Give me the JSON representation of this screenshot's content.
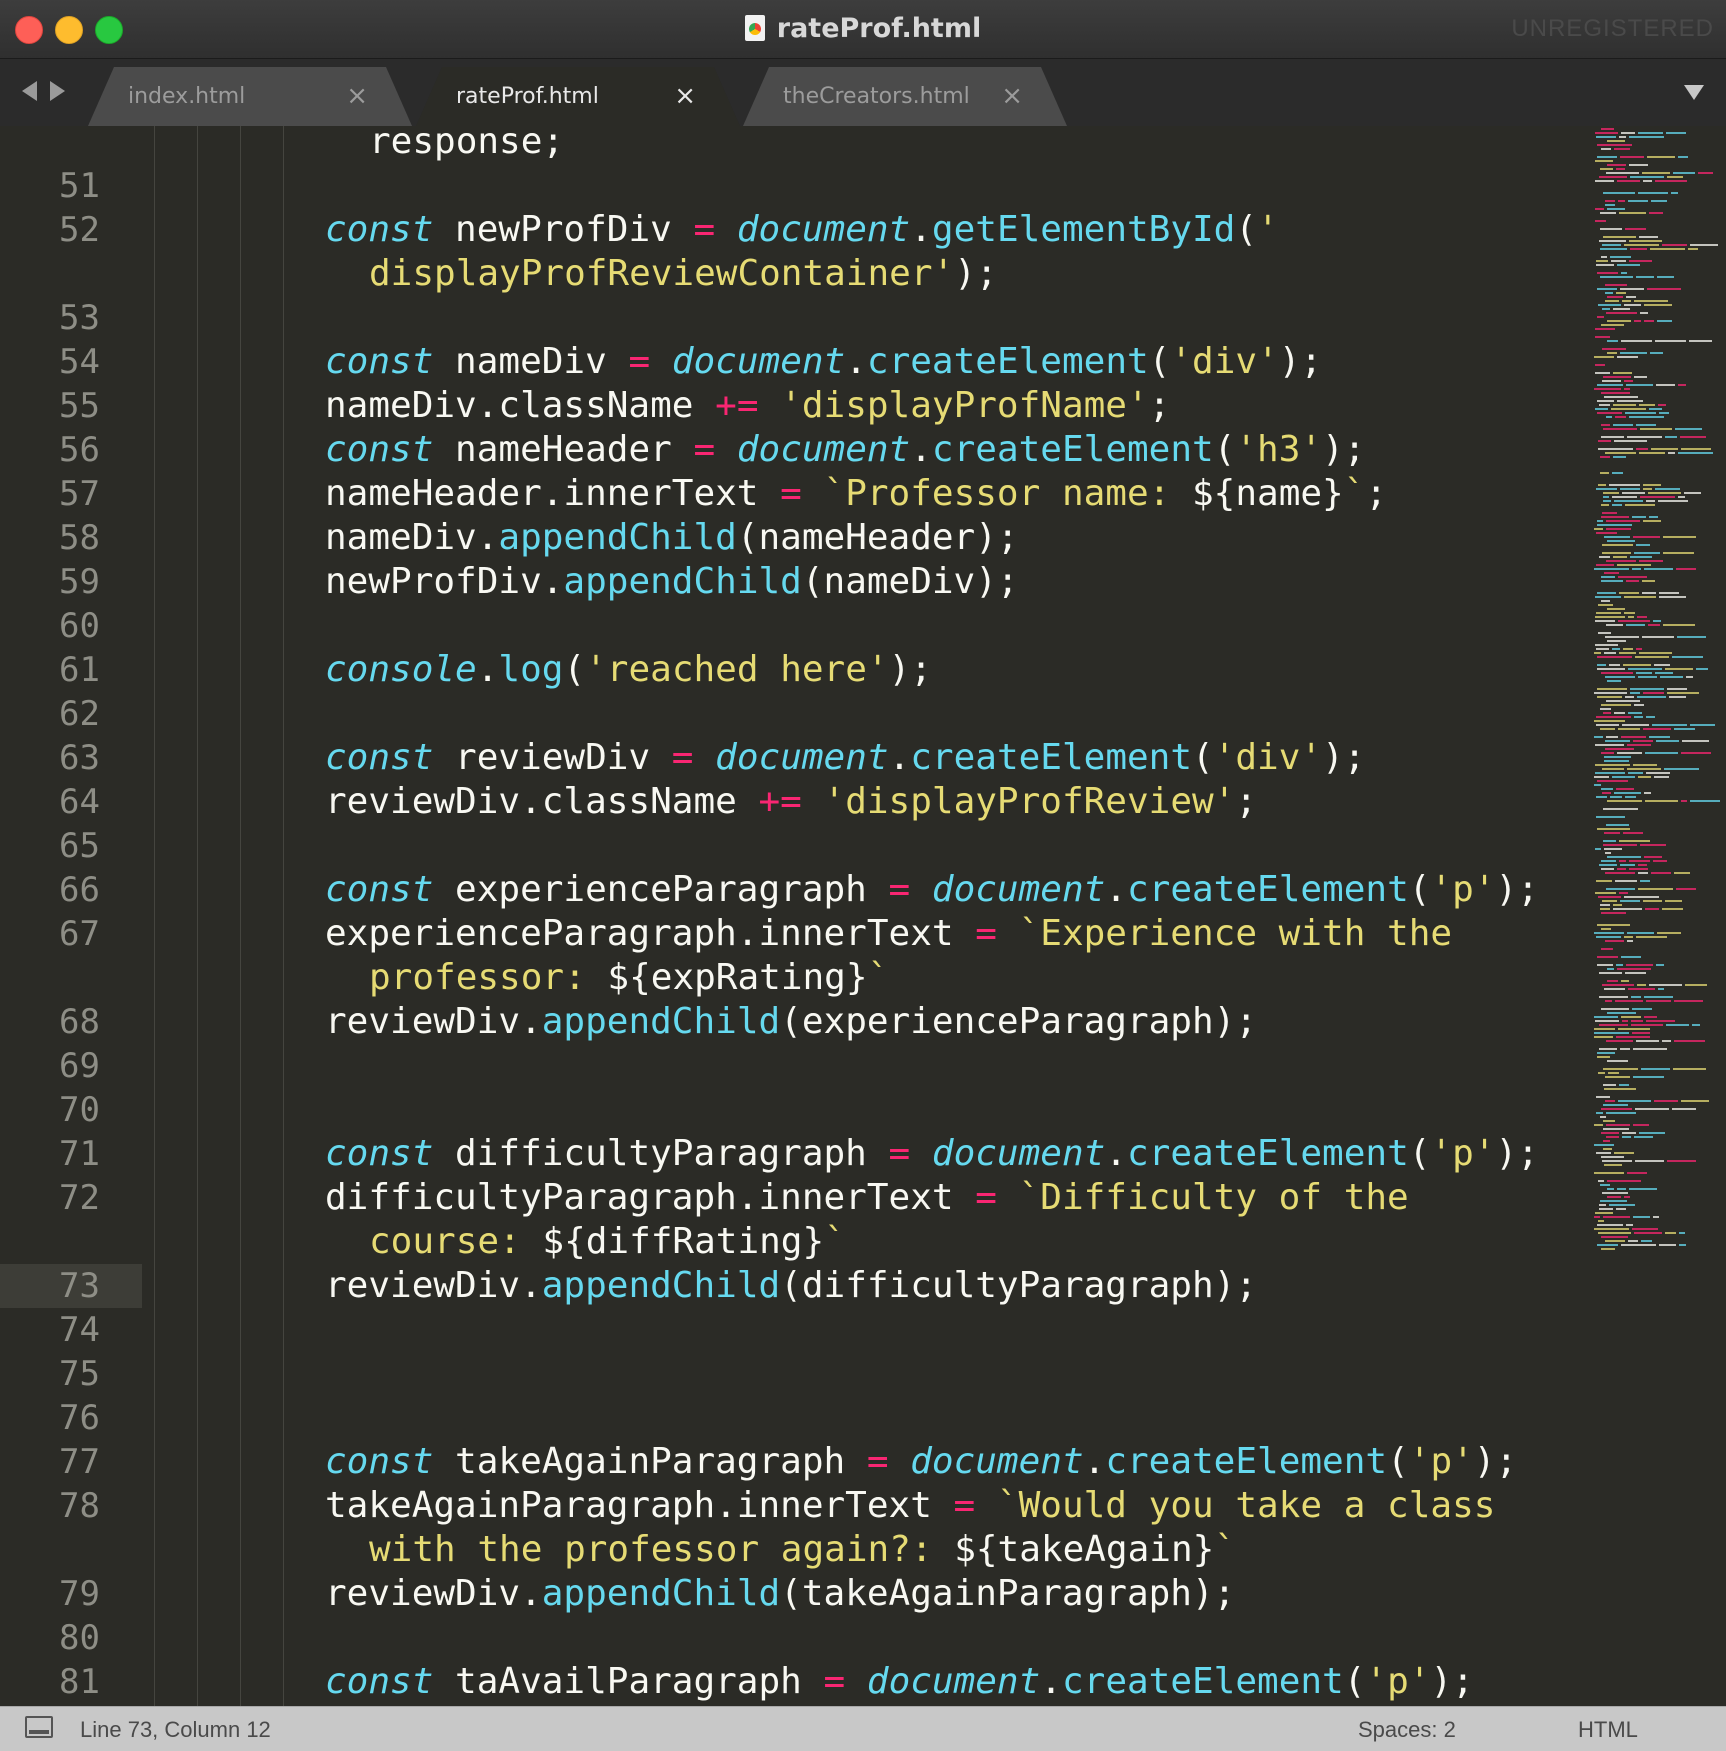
{
  "window": {
    "title": "rateProf.html",
    "registration": "UNREGISTERED"
  },
  "tabs": [
    {
      "label": "index.html",
      "active": false,
      "close": "×"
    },
    {
      "label": "rateProf.html",
      "active": true,
      "close": "×"
    },
    {
      "label": "theCreators.html",
      "active": false,
      "close": "×"
    }
  ],
  "gutter": {
    "current_line": 73,
    "rows": [
      {
        "n": ""
      },
      {
        "n": "51"
      },
      {
        "n": "52"
      },
      {
        "n": ""
      },
      {
        "n": "53"
      },
      {
        "n": "54"
      },
      {
        "n": "55"
      },
      {
        "n": "56"
      },
      {
        "n": "57"
      },
      {
        "n": "58"
      },
      {
        "n": "59"
      },
      {
        "n": "60"
      },
      {
        "n": "61"
      },
      {
        "n": "62"
      },
      {
        "n": "63"
      },
      {
        "n": "64"
      },
      {
        "n": "65"
      },
      {
        "n": "66"
      },
      {
        "n": "67"
      },
      {
        "n": ""
      },
      {
        "n": "68"
      },
      {
        "n": "69"
      },
      {
        "n": "70"
      },
      {
        "n": "71"
      },
      {
        "n": "72"
      },
      {
        "n": ""
      },
      {
        "n": "73"
      },
      {
        "n": "74"
      },
      {
        "n": "75"
      },
      {
        "n": "76"
      },
      {
        "n": "77"
      },
      {
        "n": "78"
      },
      {
        "n": ""
      },
      {
        "n": "79"
      },
      {
        "n": "80"
      },
      {
        "n": "81"
      }
    ]
  },
  "code": [
    {
      "indent": 1,
      "tokens": [
        [
          "pl",
          "response;"
        ]
      ]
    },
    {
      "indent": 0,
      "tokens": []
    },
    {
      "indent": 0,
      "tokens": [
        [
          "kw",
          "const"
        ],
        [
          "pl",
          " newProfDiv "
        ],
        [
          "op",
          "="
        ],
        [
          "pl",
          " "
        ],
        [
          "obj",
          "document"
        ],
        [
          "pl",
          "."
        ],
        [
          "fn",
          "getElementById"
        ],
        [
          "pl",
          "("
        ],
        [
          "str",
          "'"
        ]
      ]
    },
    {
      "indent": 1,
      "tokens": [
        [
          "str",
          "displayProfReviewContainer'"
        ],
        [
          "pl",
          ");"
        ]
      ]
    },
    {
      "indent": 0,
      "tokens": []
    },
    {
      "indent": 0,
      "tokens": [
        [
          "kw",
          "const"
        ],
        [
          "pl",
          " nameDiv "
        ],
        [
          "op",
          "="
        ],
        [
          "pl",
          " "
        ],
        [
          "obj",
          "document"
        ],
        [
          "pl",
          "."
        ],
        [
          "fn",
          "createElement"
        ],
        [
          "pl",
          "("
        ],
        [
          "str",
          "'div'"
        ],
        [
          "pl",
          ");"
        ]
      ]
    },
    {
      "indent": 0,
      "tokens": [
        [
          "pl",
          "nameDiv.className "
        ],
        [
          "op",
          "+="
        ],
        [
          "pl",
          " "
        ],
        [
          "str",
          "'displayProfName'"
        ],
        [
          "pl",
          ";"
        ]
      ]
    },
    {
      "indent": 0,
      "tokens": [
        [
          "kw",
          "const"
        ],
        [
          "pl",
          " nameHeader "
        ],
        [
          "op",
          "="
        ],
        [
          "pl",
          " "
        ],
        [
          "obj",
          "document"
        ],
        [
          "pl",
          "."
        ],
        [
          "fn",
          "createElement"
        ],
        [
          "pl",
          "("
        ],
        [
          "str",
          "'h3'"
        ],
        [
          "pl",
          ");"
        ]
      ]
    },
    {
      "indent": 0,
      "tokens": [
        [
          "pl",
          "nameHeader.innerText "
        ],
        [
          "op",
          "="
        ],
        [
          "pl",
          " "
        ],
        [
          "str",
          "`Professor name: "
        ],
        [
          "pl",
          "${name}"
        ],
        [
          "str",
          "`"
        ],
        [
          "pl",
          ";"
        ]
      ]
    },
    {
      "indent": 0,
      "tokens": [
        [
          "pl",
          "nameDiv."
        ],
        [
          "fn",
          "appendChild"
        ],
        [
          "pl",
          "(nameHeader);"
        ]
      ]
    },
    {
      "indent": 0,
      "tokens": [
        [
          "pl",
          "newProfDiv."
        ],
        [
          "fn",
          "appendChild"
        ],
        [
          "pl",
          "(nameDiv);"
        ]
      ]
    },
    {
      "indent": 0,
      "tokens": []
    },
    {
      "indent": 0,
      "tokens": [
        [
          "obj",
          "console"
        ],
        [
          "pl",
          "."
        ],
        [
          "fn",
          "log"
        ],
        [
          "pl",
          "("
        ],
        [
          "str",
          "'reached here'"
        ],
        [
          "pl",
          ");"
        ]
      ]
    },
    {
      "indent": 0,
      "tokens": []
    },
    {
      "indent": 0,
      "tokens": [
        [
          "kw",
          "const"
        ],
        [
          "pl",
          " reviewDiv "
        ],
        [
          "op",
          "="
        ],
        [
          "pl",
          " "
        ],
        [
          "obj",
          "document"
        ],
        [
          "pl",
          "."
        ],
        [
          "fn",
          "createElement"
        ],
        [
          "pl",
          "("
        ],
        [
          "str",
          "'div'"
        ],
        [
          "pl",
          ");"
        ]
      ]
    },
    {
      "indent": 0,
      "tokens": [
        [
          "pl",
          "reviewDiv.className "
        ],
        [
          "op",
          "+="
        ],
        [
          "pl",
          " "
        ],
        [
          "str",
          "'displayProfReview'"
        ],
        [
          "pl",
          ";"
        ]
      ]
    },
    {
      "indent": 0,
      "tokens": []
    },
    {
      "indent": 0,
      "tokens": [
        [
          "kw",
          "const"
        ],
        [
          "pl",
          " experienceParagraph "
        ],
        [
          "op",
          "="
        ],
        [
          "pl",
          " "
        ],
        [
          "obj",
          "document"
        ],
        [
          "pl",
          "."
        ],
        [
          "fn",
          "createElement"
        ],
        [
          "pl",
          "("
        ],
        [
          "str",
          "'p'"
        ],
        [
          "pl",
          ");"
        ]
      ]
    },
    {
      "indent": 0,
      "tokens": [
        [
          "pl",
          "experienceParagraph.innerText "
        ],
        [
          "op",
          "="
        ],
        [
          "pl",
          " "
        ],
        [
          "str",
          "`Experience with the"
        ]
      ]
    },
    {
      "indent": 1,
      "tokens": [
        [
          "str",
          "professor: "
        ],
        [
          "pl",
          "${expRating}"
        ],
        [
          "str",
          "`"
        ]
      ]
    },
    {
      "indent": 0,
      "tokens": [
        [
          "pl",
          "reviewDiv."
        ],
        [
          "fn",
          "appendChild"
        ],
        [
          "pl",
          "(experienceParagraph);"
        ]
      ]
    },
    {
      "indent": 0,
      "tokens": []
    },
    {
      "indent": 0,
      "tokens": []
    },
    {
      "indent": 0,
      "tokens": [
        [
          "kw",
          "const"
        ],
        [
          "pl",
          " difficultyParagraph "
        ],
        [
          "op",
          "="
        ],
        [
          "pl",
          " "
        ],
        [
          "obj",
          "document"
        ],
        [
          "pl",
          "."
        ],
        [
          "fn",
          "createElement"
        ],
        [
          "pl",
          "("
        ],
        [
          "str",
          "'p'"
        ],
        [
          "pl",
          ");"
        ]
      ]
    },
    {
      "indent": 0,
      "tokens": [
        [
          "pl",
          "difficultyParagraph.innerText "
        ],
        [
          "op",
          "="
        ],
        [
          "pl",
          " "
        ],
        [
          "str",
          "`Difficulty of the"
        ]
      ]
    },
    {
      "indent": 1,
      "tokens": [
        [
          "str",
          "course: "
        ],
        [
          "pl",
          "${diffRating}"
        ],
        [
          "str",
          "`"
        ]
      ]
    },
    {
      "indent": 0,
      "tokens": [
        [
          "pl",
          "reviewDiv."
        ],
        [
          "fn",
          "appendChild"
        ],
        [
          "pl",
          "(difficultyParagraph);"
        ]
      ]
    },
    {
      "indent": 0,
      "tokens": []
    },
    {
      "indent": 0,
      "tokens": []
    },
    {
      "indent": 0,
      "tokens": []
    },
    {
      "indent": 0,
      "tokens": [
        [
          "kw",
          "const"
        ],
        [
          "pl",
          " takeAgainParagraph "
        ],
        [
          "op",
          "="
        ],
        [
          "pl",
          " "
        ],
        [
          "obj",
          "document"
        ],
        [
          "pl",
          "."
        ],
        [
          "fn",
          "createElement"
        ],
        [
          "pl",
          "("
        ],
        [
          "str",
          "'p'"
        ],
        [
          "pl",
          ");"
        ]
      ]
    },
    {
      "indent": 0,
      "tokens": [
        [
          "pl",
          "takeAgainParagraph.innerText "
        ],
        [
          "op",
          "="
        ],
        [
          "pl",
          " "
        ],
        [
          "str",
          "`Would you take a class"
        ]
      ]
    },
    {
      "indent": 1,
      "tokens": [
        [
          "str",
          "with the professor again?: "
        ],
        [
          "pl",
          "${takeAgain}"
        ],
        [
          "str",
          "`"
        ]
      ]
    },
    {
      "indent": 0,
      "tokens": [
        [
          "pl",
          "reviewDiv."
        ],
        [
          "fn",
          "appendChild"
        ],
        [
          "pl",
          "(takeAgainParagraph);"
        ]
      ]
    },
    {
      "indent": 0,
      "tokens": []
    },
    {
      "indent": 0,
      "tokens": [
        [
          "kw",
          "const"
        ],
        [
          "pl",
          " taAvailParagraph "
        ],
        [
          "op",
          "="
        ],
        [
          "pl",
          " "
        ],
        [
          "obj",
          "document"
        ],
        [
          "pl",
          "."
        ],
        [
          "fn",
          "createElement"
        ],
        [
          "pl",
          "("
        ],
        [
          "str",
          "'p'"
        ],
        [
          "pl",
          ");"
        ]
      ]
    }
  ],
  "syntax_colors": {
    "keyword": "#66d9ef",
    "function": "#66d9ef",
    "operator": "#f92672",
    "string": "#e6db74",
    "plain": "#f8f8f2",
    "background": "#2b2b26"
  },
  "statusbar": {
    "position": "Line 73, Column 12",
    "indentation": "Spaces: 2",
    "syntax": "HTML"
  }
}
